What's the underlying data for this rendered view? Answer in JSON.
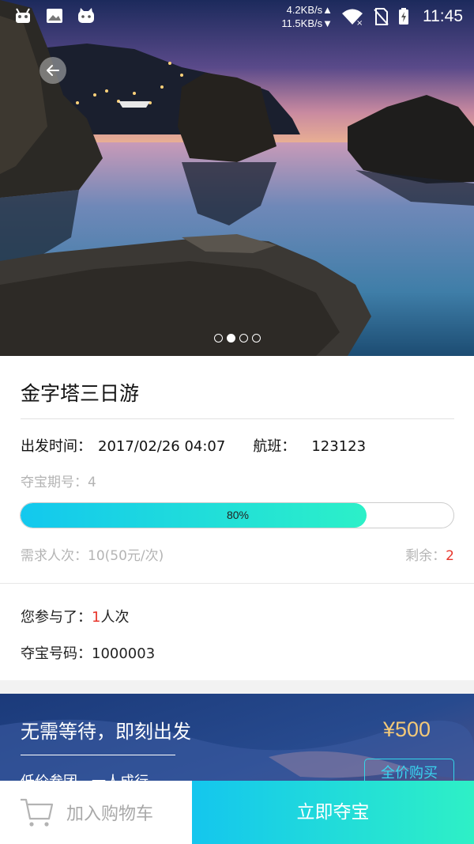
{
  "status_bar": {
    "net_up": "4.2KB/s",
    "net_down": "11.5KB/s",
    "time": "11:45"
  },
  "hero": {
    "slide_count": 4,
    "active_slide": 1
  },
  "product": {
    "title": "金字塔三日游",
    "departure_label": "出发时间：",
    "departure_value": "2017/02/26 04:07",
    "flight_label": "航班：",
    "flight_value": "123123",
    "period_label": "夺宝期号：",
    "period_value": "4",
    "progress_fraction": 0.8,
    "progress_text": "80%",
    "demand_label": "需求人次：",
    "demand_value": "10(50元/次)",
    "remain_label": "剩余：",
    "remain_value": "2",
    "participated_label": "您参与了：",
    "participated_count": "1",
    "participated_unit": "人次",
    "code_label": "夺宝号码：",
    "code_value": "1000003"
  },
  "promo": {
    "title": "无需等待，即刻出发",
    "subtitle": "低价参团，一人成行",
    "price": "¥500",
    "full_buy_label": "全价购买"
  },
  "bottom_bar": {
    "cart_label": "加入购物车",
    "grab_label": "立即夺宝"
  },
  "colors": {
    "accent_start": "#14c6ee",
    "accent_end": "#2ef0c6",
    "highlight_red": "#e8362c",
    "price_gold": "#f3c978"
  }
}
